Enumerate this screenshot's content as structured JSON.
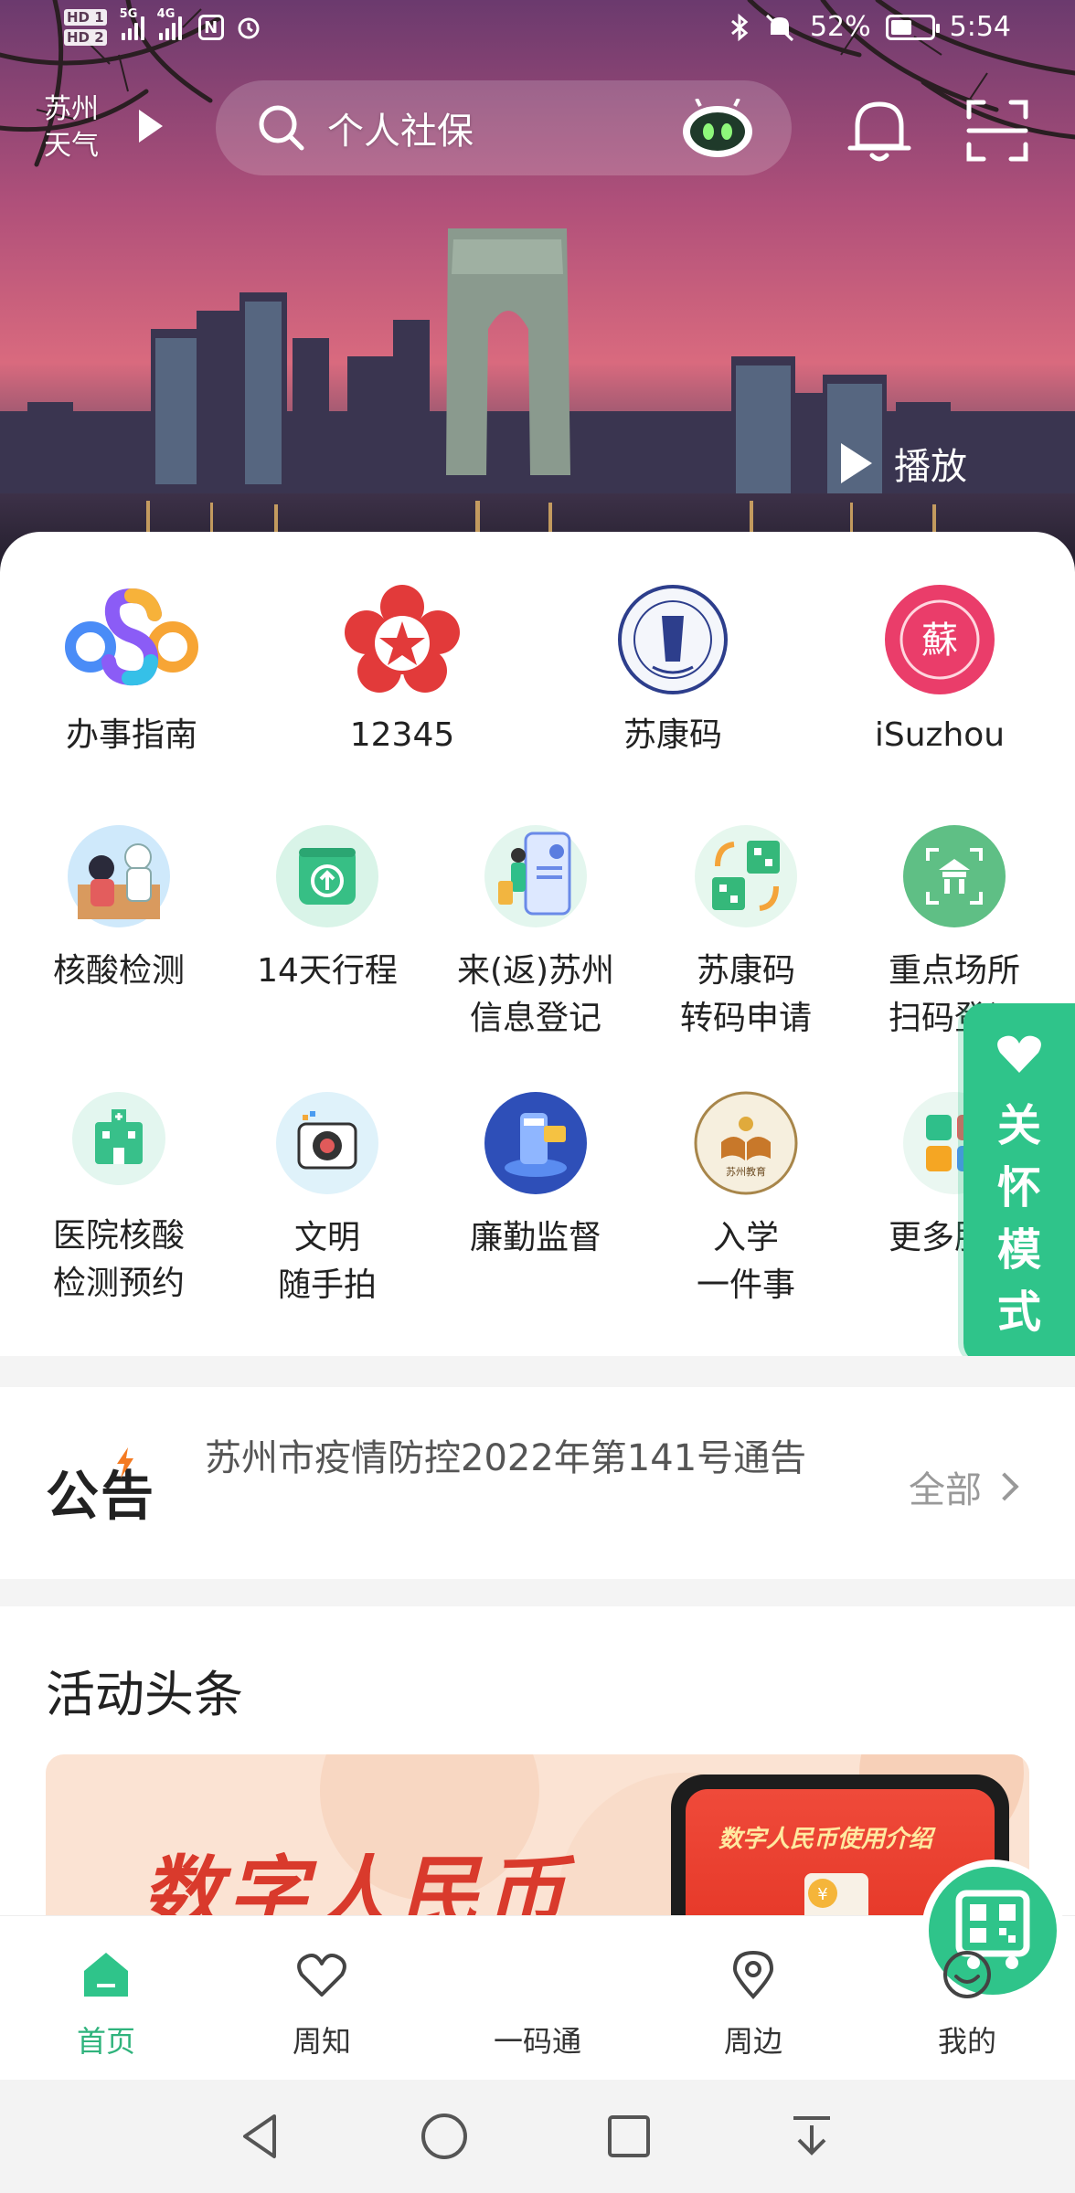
{
  "status_bar": {
    "hd1": "HD 1",
    "hd2": "HD 2",
    "network_5g": "5G",
    "network_4g": "4G",
    "nfc": "N",
    "battery_percent": "52%",
    "battery_level": 0.52,
    "time": "5:54"
  },
  "header": {
    "weather_line1": "苏州",
    "weather_line2": "天气",
    "search_placeholder": "个人社保",
    "play_label": "播放"
  },
  "services_top": [
    {
      "label": "办事指南",
      "icon": "colorful-s-logo-icon"
    },
    {
      "label": "12345",
      "icon": "red-star-hotline-icon"
    },
    {
      "label": "苏康码",
      "icon": "health-commission-seal-icon"
    },
    {
      "label": "iSuzhou",
      "icon": "su-character-badge-icon"
    }
  ],
  "services_row2": [
    {
      "label1": "核酸检测",
      "label2": "",
      "icon": "nucleic-test-icon"
    },
    {
      "label1": "14天行程",
      "label2": "",
      "icon": "travel-record-icon"
    },
    {
      "label1": "来(返)苏州",
      "label2": "信息登记",
      "icon": "arrival-registration-icon"
    },
    {
      "label1": "苏康码",
      "label2": "转码申请",
      "icon": "code-conversion-icon"
    },
    {
      "label1": "重点场所",
      "label2": "扫码登记",
      "icon": "venue-scan-icon"
    }
  ],
  "services_row3": [
    {
      "label1": "医院核酸",
      "label2": "检测预约",
      "icon": "hospital-icon"
    },
    {
      "label1": "文明",
      "label2": "随手拍",
      "icon": "camera-icon"
    },
    {
      "label1": "廉勤监督",
      "label2": "",
      "icon": "supervision-icon"
    },
    {
      "label1": "入学",
      "label2": "一件事",
      "icon": "suzhou-education-icon"
    },
    {
      "label1": "更多服务",
      "label2": "",
      "icon": "more-services-icon"
    }
  ],
  "care_mode": {
    "chars": [
      "关",
      "怀",
      "模",
      "式"
    ]
  },
  "notice": {
    "logo_text": "公告",
    "text": "苏州市疫情防控2022年第141号通告",
    "all_label": "全部"
  },
  "activity": {
    "title": "活动头条",
    "banner_text": "数字人民币",
    "banner_phone_title": "数字人民币使用介绍"
  },
  "bottom_nav": [
    {
      "label": "首页",
      "icon": "home-icon",
      "active": true
    },
    {
      "label": "周知",
      "icon": "heart-icon",
      "active": false
    },
    {
      "label": "一码通",
      "icon": "qr-code-icon",
      "active": false
    },
    {
      "label": "周边",
      "icon": "location-pin-icon",
      "active": false
    },
    {
      "label": "我的",
      "icon": "smiley-icon",
      "active": false
    }
  ],
  "colors": {
    "accent": "#2fc48a",
    "active_nav": "#2fb37c",
    "notice_flash": "#f47a21"
  }
}
